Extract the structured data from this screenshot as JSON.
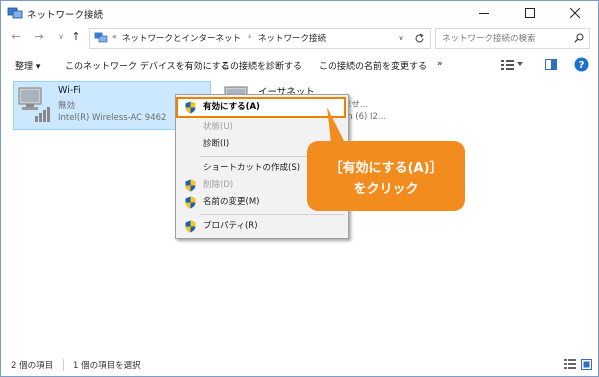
{
  "window": {
    "title": "ネットワーク接続",
    "controls": {
      "minimize": "—",
      "maximize": "☐",
      "close": "✕"
    }
  },
  "nav": {
    "back": "←",
    "forward": "→",
    "recent": "∨",
    "up": "↑"
  },
  "address": {
    "overflow": "«",
    "crumb1": "ネットワークとインターネット",
    "separator": "›",
    "crumb2": "ネットワーク接続",
    "dropdown": "∨"
  },
  "search": {
    "placeholder": "ネットワーク接続の検索"
  },
  "commands": {
    "organize": "整理 ▾",
    "enable": "このネットワーク デバイスを有効にする",
    "diagnose": "この接続を診断する",
    "rename": "この接続の名前を変更する",
    "more": "»"
  },
  "items": [
    {
      "name": "Wi-Fi",
      "status": "無効",
      "adapter": "Intel(R) Wireless-AC 9462"
    },
    {
      "name": "イーサネット",
      "status": "続されていませ...",
      "adapter": "nection (6) I2..."
    }
  ],
  "context_menu": [
    {
      "label": "有効にする(A)",
      "shield": true,
      "disabled": false,
      "highlighted": true
    },
    {
      "label": "状態(U)",
      "shield": false,
      "disabled": true
    },
    {
      "label": "診断(I)",
      "shield": false,
      "disabled": false
    },
    {
      "label": "ショートカットの作成(S)",
      "shield": false,
      "disabled": false
    },
    {
      "label": "削除(D)",
      "shield": true,
      "disabled": true
    },
    {
      "label": "名前の変更(M)",
      "shield": true,
      "disabled": false
    },
    {
      "label": "プロパティ(R)",
      "shield": true,
      "disabled": false
    }
  ],
  "callout": {
    "line1": "［有効にする(A)］",
    "line2": "をクリック",
    "color": "#f28c1e"
  },
  "status": {
    "item_count": "2 個の項目",
    "selected": "1 個の項目を選択"
  },
  "colors": {
    "selection": "#cce8ff",
    "highlight_outline": "#f08000",
    "help": "#1a73c8"
  }
}
